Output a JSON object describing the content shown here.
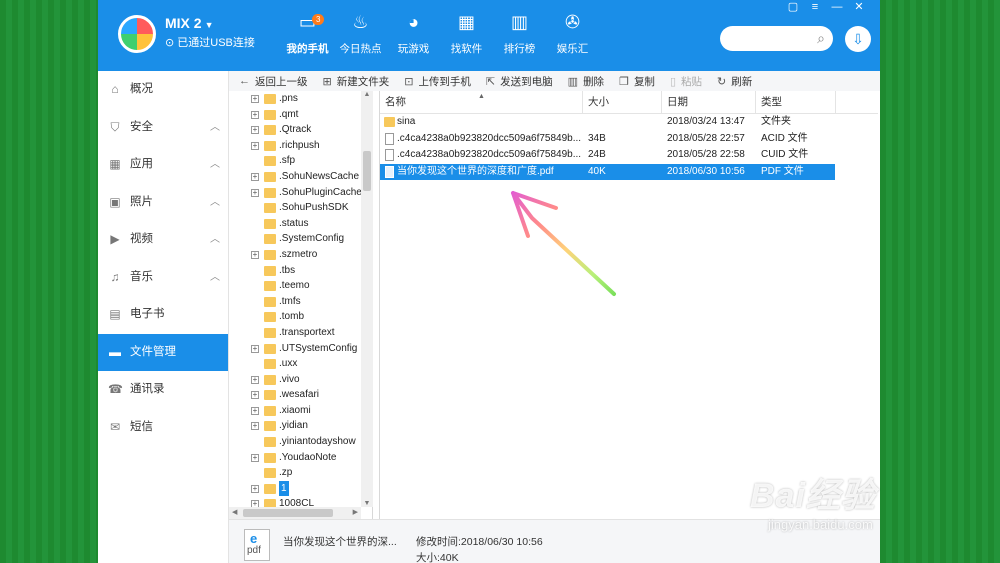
{
  "header": {
    "device_name": "MIX 2",
    "device_status": "已通过USB连接",
    "nav": [
      {
        "label": "我的手机",
        "icon": "phone-icon",
        "badge": "3"
      },
      {
        "label": "今日热点",
        "icon": "flame-icon"
      },
      {
        "label": "玩游戏",
        "icon": "gamepad-icon"
      },
      {
        "label": "找软件",
        "icon": "apps-icon"
      },
      {
        "label": "排行榜",
        "icon": "ranking-icon"
      },
      {
        "label": "娱乐汇",
        "icon": "film-reel-icon"
      }
    ]
  },
  "sidebar": {
    "items": [
      {
        "label": "概况",
        "icon": "home-icon"
      },
      {
        "label": "安全",
        "icon": "shield-icon"
      },
      {
        "label": "应用",
        "icon": "apps-icon"
      },
      {
        "label": "照片",
        "icon": "photo-icon"
      },
      {
        "label": "视频",
        "icon": "video-icon"
      },
      {
        "label": "音乐",
        "icon": "music-icon"
      },
      {
        "label": "电子书",
        "icon": "book-icon"
      },
      {
        "label": "文件管理",
        "icon": "folder-icon"
      },
      {
        "label": "通讯录",
        "icon": "contacts-icon"
      },
      {
        "label": "短信",
        "icon": "sms-icon"
      }
    ]
  },
  "toolbar": {
    "back": "返回上一级",
    "new_folder": "新建文件夹",
    "upload": "上传到手机",
    "send_pc": "发送到电脑",
    "delete": "删除",
    "copy": "复制",
    "paste": "粘贴",
    "refresh": "刷新"
  },
  "tree": {
    "items": [
      ".pns",
      ".qmt",
      ".Qtrack",
      ".richpush",
      ".sfp",
      ".SohuNewsCache",
      ".SohuPluginCache",
      ".SohuPushSDK",
      ".status",
      ".SystemConfig",
      ".szmetro",
      ".tbs",
      ".teemo",
      ".tmfs",
      ".tomb",
      ".transportext",
      ".UTSystemConfig",
      ".uxx",
      ".vivo",
      ".wesafari",
      ".xiaomi",
      ".yidian",
      ".yiniantodayshow",
      ".YoudaoNote",
      ".zp",
      "1",
      "1008CL"
    ]
  },
  "list": {
    "headers": {
      "name": "名称",
      "size": "大小",
      "date": "日期",
      "type": "类型"
    },
    "rows": [
      {
        "name": "sina",
        "size": "",
        "date": "2018/03/24 13:47",
        "type": "文件夹"
      },
      {
        "name": ".c4ca4238a0b923820dcc509a6f75849b...",
        "size": "34B",
        "date": "2018/05/28 22:57",
        "type": "ACID 文件"
      },
      {
        "name": ".c4ca4238a0b923820dcc509a6f75849b...",
        "size": "24B",
        "date": "2018/05/28 22:58",
        "type": "CUID 文件"
      },
      {
        "name": "当你发现这个世界的深度和广度.pdf",
        "size": "40K",
        "date": "2018/06/30 10:56",
        "type": "PDF 文件"
      }
    ]
  },
  "status": {
    "file_name": "当你发现这个世界的深...",
    "mtime": "修改时间:2018/06/30 10:56",
    "size": "大小:40K",
    "pdf_label": "pdf"
  },
  "watermark": {
    "logo": "Bai经验",
    "url": "jingyan.baidu.com"
  },
  "colors": {
    "primary": "#1a8ee8",
    "background_green": "#1f8a32",
    "folder": "#f7c85b"
  }
}
